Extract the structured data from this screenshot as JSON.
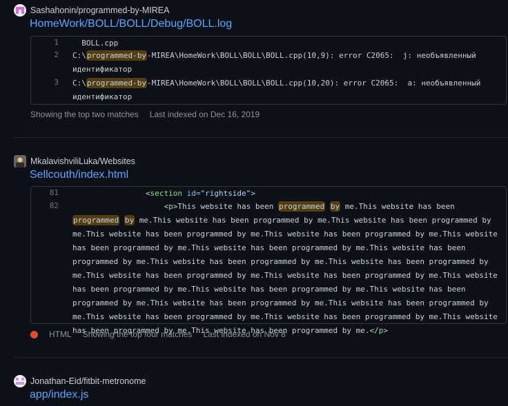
{
  "results": [
    {
      "repo": "Sashahonin/programmed-by-MIREA",
      "file": "HomeWork/BOLL/BOLL/Debug/BOLL.log",
      "lines": [
        {
          "num": "1",
          "text": "  BOLL.cpp"
        },
        {
          "num": "2",
          "pre": "C:\\",
          "hl": "programmed-by",
          "post": "-MIREA\\HomeWork\\BOLL\\BOLL\\BOLL.cpp(10,9): error C2065:  j: необъявленный идентификатор"
        },
        {
          "num": "3",
          "pre": "C:\\",
          "hl": "programmed-by",
          "post": "-MIREA\\HomeWork\\BOLL\\BOLL\\BOLL.cpp(10,20): error C2065:  a: необъявленный идентификатор"
        }
      ],
      "matches": "Showing the top two matches",
      "indexed": "Last indexed on Dec 16, 2019"
    },
    {
      "repo": "MkalavishviliLuka/Websites",
      "file": "Sellcouth/index.html",
      "line81": {
        "num": "81",
        "indent": "                ",
        "open": "<",
        "tag": "section",
        "attr": " id=",
        "str": "\"rightside\"",
        "close": ">"
      },
      "line82": {
        "num": "82",
        "indent": "                    ",
        "p_open_lt": "<",
        "p_tag": "p",
        "p_open_gt": ">",
        "t1": "This website has been ",
        "hl1": "programmed",
        "sp1": " ",
        "hl2": "by",
        "t2": " me.This website has been ",
        "hl3": "programmed",
        "sp2": " ",
        "hl4": "by",
        "t3": " me.This website has been programmed by me.This website has been programmed by me.This website has been programmed by me.This website has been programmed by me.This website has been programmed by me.This website has been programmed by me.This website has been programmed by me.This website has been programmed by me.This website has been programmed by me.This website has been programmed by me.This website has been programmed by me.This website has been programmed by me.This website has been programmed by me.This website has been programmed by me.This website has been programmed by me.This website has been programmed by me.This website has been programmed by me.This website has been programmed by me.This website has been programmed by me.This website has been programmed by me.",
        "p_close_lt": "</",
        "p_close_tag": "p",
        "p_close_gt": ">"
      },
      "language": "HTML",
      "language_color": "#e34c26",
      "matches": "Showing the top four matches",
      "indexed": "Last indexed on Nov 8"
    },
    {
      "repo": "Jonathan-Eid/fitbit-metronome",
      "file": "app/index.js"
    }
  ]
}
